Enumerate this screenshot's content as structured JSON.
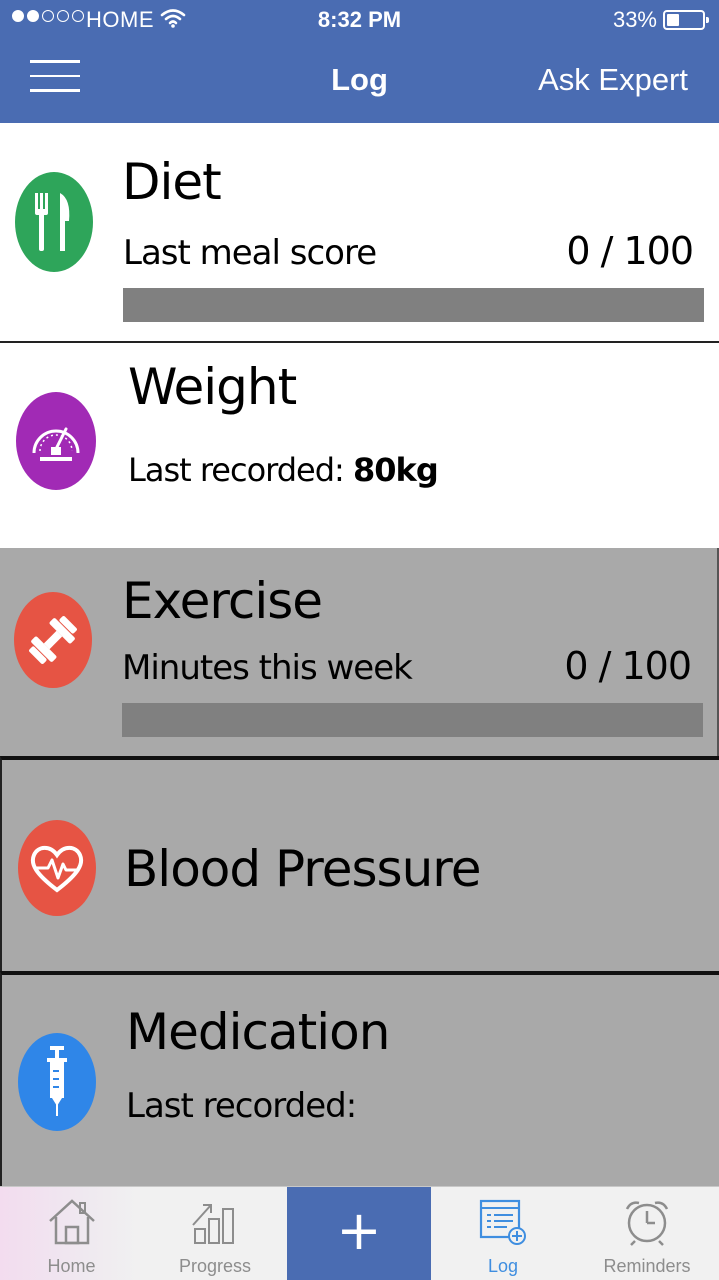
{
  "status_bar": {
    "carrier": "HOME",
    "time": "8:32 PM",
    "battery": "33%",
    "battery_level": 0.33,
    "signal_bars_filled": 2,
    "signal_bars_total": 5
  },
  "nav": {
    "title": "Log",
    "right_button": "Ask Expert",
    "color": "#4a6cb2"
  },
  "cards": {
    "diet": {
      "title": "Diet",
      "subtitle": "Last meal score",
      "score": "0 / 100",
      "progress": 0,
      "icon": "fork-knife-icon",
      "icon_color": "#2ea55a"
    },
    "weight": {
      "title": "Weight",
      "subtitle_prefix": "Last recorded: ",
      "value": "80kg",
      "icon": "scale-gauge-icon",
      "icon_color": "#a12ab5"
    },
    "exercise": {
      "title": "Exercise",
      "subtitle": "Minutes this week",
      "score": "0 / 100",
      "progress": 0,
      "icon": "dumbbell-icon",
      "icon_color": "#e65444"
    },
    "blood_pressure": {
      "title": "Blood Pressure",
      "icon": "heart-pulse-icon",
      "icon_color": "#e65444"
    },
    "medication": {
      "title": "Medication",
      "subtitle": "Last recorded:",
      "icon": "syringe-icon",
      "icon_color": "#2f86e8"
    }
  },
  "tabs": {
    "home": "Home",
    "progress": "Progress",
    "add": "+",
    "log": "Log",
    "reminders": "Reminders",
    "active": "log"
  }
}
